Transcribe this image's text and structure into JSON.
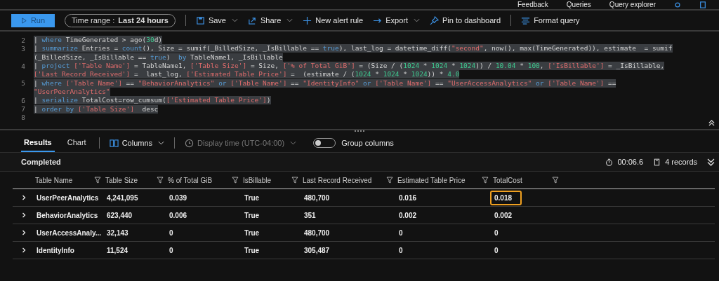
{
  "top_bar": {
    "items": [
      "Feedback",
      "Queries",
      "Query explorer"
    ]
  },
  "toolbar": {
    "run": "Run",
    "time_range": "Time range : **Last 24 hours**",
    "actions": [
      {
        "label": "Save",
        "has_menu": true
      },
      {
        "label": "Share",
        "has_menu": true
      },
      {
        "label": "New alert rule",
        "has_menu": false
      },
      {
        "label": "Export",
        "has_menu": true
      },
      {
        "label": "Pin to dashboard",
        "has_menu": false
      },
      {
        "label": "Format query",
        "has_menu": false
      }
    ]
  },
  "editor": {
    "lines": [
      {
        "number": "2",
        "segments": [
          {
            "kind": "plain",
            "text": "| "
          },
          {
            "kind": "keyword",
            "text": "where"
          },
          {
            "kind": "plain",
            "text": " TimeGenerated > ago("
          },
          {
            "kind": "number",
            "text": "30"
          },
          {
            "kind": "plain",
            "text": "d)"
          }
        ]
      },
      {
        "number": "3",
        "segments": [
          {
            "kind": "plain",
            "text": "| "
          },
          {
            "kind": "keyword",
            "text": "summarize"
          },
          {
            "kind": "plain",
            "text": " Entries = "
          },
          {
            "kind": "keyword",
            "text": "count"
          },
          {
            "kind": "plain",
            "text": "(), Size = sumif(_BilledSize, _IsBillable == "
          },
          {
            "kind": "keyword",
            "text": "true"
          },
          {
            "kind": "plain",
            "text": "), last_log = datetime_diff("
          },
          {
            "kind": "string",
            "text": "\"second\""
          },
          {
            "kind": "plain",
            "text": ", now(), max(TimeGenerated)), estimate  = sumif"
          }
        ]
      },
      {
        "segments": [
          {
            "kind": "plain",
            "text": "(_BilledSize, _IsBillable == "
          },
          {
            "kind": "keyword",
            "text": "true"
          },
          {
            "kind": "plain",
            "text": ")  "
          },
          {
            "kind": "keyword",
            "text": "by"
          },
          {
            "kind": "plain",
            "text": " TableName1, _IsBillable"
          }
        ]
      },
      {
        "number": "4",
        "segments": [
          {
            "kind": "plain",
            "text": "| "
          },
          {
            "kind": "keyword",
            "text": "project "
          },
          {
            "kind": "string",
            "text": "['Table Name']"
          },
          {
            "kind": "plain",
            "text": " = TableName1, "
          },
          {
            "kind": "string",
            "text": "['Table Size']"
          },
          {
            "kind": "plain",
            "text": " = Size, "
          },
          {
            "kind": "string",
            "text": "['% of Total GiB']"
          },
          {
            "kind": "plain",
            "text": " = (Size / ("
          },
          {
            "kind": "number",
            "text": "1024"
          },
          {
            "kind": "plain",
            "text": " * "
          },
          {
            "kind": "number",
            "text": "1024"
          },
          {
            "kind": "plain",
            "text": " * "
          },
          {
            "kind": "number",
            "text": "1024"
          },
          {
            "kind": "plain",
            "text": ")) / "
          },
          {
            "kind": "number",
            "text": "10.04"
          },
          {
            "kind": "plain",
            "text": " * "
          },
          {
            "kind": "number",
            "text": "100"
          },
          {
            "kind": "plain",
            "text": ", "
          },
          {
            "kind": "string",
            "text": "['IsBillable']"
          },
          {
            "kind": "plain",
            "text": " = _IsBillable,"
          }
        ]
      },
      {
        "segments": [
          {
            "kind": "string",
            "text": "['Last Record Received']"
          },
          {
            "kind": "plain",
            "text": " =  last_log, "
          },
          {
            "kind": "string",
            "text": "['Estimated Table Price']"
          },
          {
            "kind": "plain",
            "text": " =  (estimate / ("
          },
          {
            "kind": "number",
            "text": "1024"
          },
          {
            "kind": "plain",
            "text": " * "
          },
          {
            "kind": "number",
            "text": "1024"
          },
          {
            "kind": "plain",
            "text": " * "
          },
          {
            "kind": "number",
            "text": "1024"
          },
          {
            "kind": "plain",
            "text": ")) * "
          },
          {
            "kind": "number",
            "text": "4.0"
          }
        ]
      },
      {
        "number": "5",
        "segments": [
          {
            "kind": "plain",
            "text": "| "
          },
          {
            "kind": "keyword",
            "text": "where "
          },
          {
            "kind": "string",
            "text": "['Table Name']"
          },
          {
            "kind": "plain",
            "text": " == "
          },
          {
            "kind": "string",
            "text": "\"BehaviorAnalytics\" "
          },
          {
            "kind": "keyword",
            "text": "or "
          },
          {
            "kind": "string",
            "text": "['Table Name']"
          },
          {
            "kind": "plain",
            "text": " == "
          },
          {
            "kind": "string",
            "text": "\"IdentityInfo\" "
          },
          {
            "kind": "keyword",
            "text": "or "
          },
          {
            "kind": "string",
            "text": "['Table Name']"
          },
          {
            "kind": "plain",
            "text": " == "
          },
          {
            "kind": "string",
            "text": "\"UserAccessAnalytics\" "
          },
          {
            "kind": "keyword",
            "text": "or "
          },
          {
            "kind": "string",
            "text": "['Table Name']"
          },
          {
            "kind": "plain",
            "text": " =="
          }
        ]
      },
      {
        "segments": [
          {
            "kind": "string",
            "text": "\"UserPeerAnalytics\""
          }
        ]
      },
      {
        "number": "6",
        "segments": [
          {
            "kind": "plain",
            "text": "| "
          },
          {
            "kind": "keyword",
            "text": "serialize"
          },
          {
            "kind": "plain",
            "text": " TotalCost=row_cumsum("
          },
          {
            "kind": "string",
            "text": "['Estimated Table Price']"
          },
          {
            "kind": "plain",
            "text": ")"
          }
        ]
      },
      {
        "number": "7",
        "segments": [
          {
            "kind": "plain",
            "text": "| "
          },
          {
            "kind": "keyword",
            "text": "order by "
          },
          {
            "kind": "string",
            "text": "['Table Size']"
          },
          {
            "kind": "plain",
            "text": "  desc"
          }
        ]
      },
      {
        "number": "8"
      }
    ]
  },
  "results": {
    "tabs": [
      {
        "label": "Results",
        "selected": true
      },
      {
        "label": "Chart",
        "selected": false
      }
    ],
    "columns_button": "Columns",
    "display_time": {
      "label": "Display time (UTC-04:00)",
      "disabled": true
    },
    "group_columns": {
      "label": "Group columns",
      "on": false
    },
    "status": "Completed",
    "duration": "00:06.6",
    "records": "4 records",
    "table": {
      "columns": [
        "Table Name",
        "Table Size",
        "% of Total GiB",
        "IsBillable",
        "Last Record Received",
        "Estimated Table Price",
        "TotalCost"
      ],
      "rows": [
        {
          "expanded": false,
          "cells": [
            {
              "text": "UserPeerAnalytics",
              "focused": false
            },
            {
              "text": "4,241,095",
              "focused": false
            },
            {
              "text": "0.039",
              "focused": false
            },
            {
              "text": "True",
              "focused": false
            },
            {
              "text": "480,700",
              "focused": false
            },
            {
              "text": "0.016",
              "focused": false
            },
            {
              "text": "0.018",
              "focused": true
            }
          ]
        },
        {
          "expanded": false,
          "cells": [
            {
              "text": "BehaviorAnalytics",
              "focused": false
            },
            {
              "text": "623,440",
              "focused": false
            },
            {
              "text": "0.006",
              "focused": false
            },
            {
              "text": "True",
              "focused": false
            },
            {
              "text": "351",
              "focused": false
            },
            {
              "text": "0.002",
              "focused": false
            },
            {
              "text": "0.002",
              "focused": false
            }
          ]
        },
        {
          "expanded": false,
          "cells": [
            {
              "text": "UserAccessAnaly...",
              "focused": false
            },
            {
              "text": "32,143",
              "focused": false
            },
            {
              "text": "0",
              "focused": false
            },
            {
              "text": "True",
              "focused": false
            },
            {
              "text": "480,700",
              "focused": false
            },
            {
              "text": "0",
              "focused": false
            },
            {
              "text": "0",
              "focused": false
            }
          ]
        },
        {
          "expanded": false,
          "cells": [
            {
              "text": "IdentityInfo",
              "focused": false
            },
            {
              "text": "11,524",
              "focused": false
            },
            {
              "text": "0",
              "focused": false
            },
            {
              "text": "True",
              "focused": false
            },
            {
              "text": "305,487",
              "focused": false
            },
            {
              "text": "0",
              "focused": false
            },
            {
              "text": "0",
              "focused": false
            }
          ]
        }
      ]
    }
  }
}
